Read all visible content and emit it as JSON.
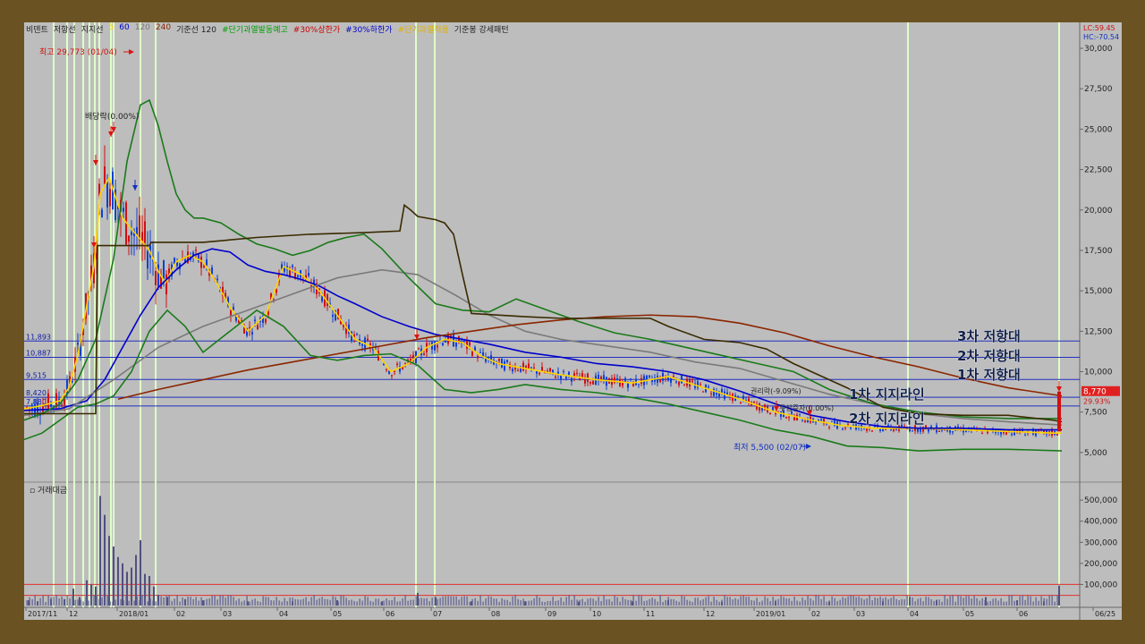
{
  "legend": [
    {
      "text": "비덴트",
      "color": "#222222"
    },
    {
      "text": "저항선",
      "color": "#222222"
    },
    {
      "text": "지지선",
      "color": "#222222"
    },
    {
      "text": "5",
      "color": "#ffd400"
    },
    {
      "text": "60",
      "color": "#0000cc"
    },
    {
      "text": "120",
      "color": "#777777"
    },
    {
      "text": "240",
      "color": "#8b2500"
    },
    {
      "text": "기준선 120",
      "color": "#222222"
    },
    {
      "text": "#단기과열발동예고",
      "color": "#00a000"
    },
    {
      "text": "#30%상한가",
      "color": "#cc0000"
    },
    {
      "text": "#30%하한가",
      "color": "#0000cc"
    },
    {
      "text": "#단기과열적용",
      "color": "#e0b000"
    },
    {
      "text": "기준봉 강세패턴",
      "color": "#222222"
    }
  ],
  "corner": {
    "lc": "LC:59.45",
    "hc": "HC:-70.54"
  },
  "volume_label": "거래대금",
  "annotations": {
    "high": "최고 29,773 (01/04)",
    "low": "최저 5,500 (02/07)",
    "dividend": "배당락(0.00%)",
    "rights": "권리락(-9.09%)",
    "bonus": "무상증자(0.00%)",
    "resist3": "3차 저항대",
    "resist2": "2차 저항대",
    "resist1": "1차 저항대",
    "support1": "1차 지지라인",
    "support2": "2차 지지라인",
    "current_price": "8,770",
    "current_change": "29.93%"
  },
  "chart_data": {
    "type": "line",
    "title": "",
    "x_ticks": [
      "2017/11",
      "12",
      "2018/01",
      "02",
      "03",
      "04",
      "05",
      "06",
      "07",
      "08",
      "09",
      "10",
      "11",
      "12",
      "2019/01",
      "02",
      "03",
      "04",
      "05",
      "06",
      "06/25"
    ],
    "y_ticks": [
      "30,000",
      "27,500",
      "25,000",
      "22,500",
      "20,000",
      "17,500",
      "15,000",
      "12,500",
      "10,000",
      "7,500",
      "5,000"
    ],
    "ylim": [
      3500,
      30500
    ],
    "level_lines": [
      {
        "value": 11893,
        "label": "11,893"
      },
      {
        "value": 10887,
        "label": "10,887"
      },
      {
        "value": 9515,
        "label": "9,515"
      },
      {
        "value": 8420,
        "label": "8,420"
      },
      {
        "value": 7880,
        "label": "7,880"
      }
    ],
    "series": [
      {
        "color": "#ffd400",
        "x": [
          0,
          20,
          40,
          50,
          60,
          68,
          78,
          85,
          95,
          110,
          125,
          140,
          150,
          158,
          170,
          185,
          200,
          215,
          230,
          250,
          270,
          290,
          310,
          330,
          350,
          370,
          390,
          410,
          430,
          450,
          470,
          490,
          510,
          530,
          560,
          600,
          640,
          680,
          720,
          760,
          800,
          840,
          880,
          910,
          950,
          1000,
          1050,
          1100,
          1150,
          1160
        ],
        "y": [
          7700,
          7900,
          8200,
          9000,
          11000,
          13500,
          16500,
          21000,
          22000,
          19500,
          18500,
          17500,
          16200,
          15500,
          16800,
          17200,
          16800,
          15500,
          14000,
          12500,
          13500,
          16500,
          16000,
          15000,
          13500,
          12000,
          11500,
          10000,
          10500,
          11500,
          12000,
          11800,
          11000,
          10500,
          10200,
          9800,
          9500,
          9300,
          9700,
          9000,
          8300,
          7500,
          7000,
          6700,
          6500,
          6500,
          6400,
          6300,
          6200,
          6200
        ]
      },
      {
        "color": "#0000cc",
        "x": [
          0,
          40,
          70,
          90,
          110,
          130,
          150,
          170,
          190,
          210,
          230,
          250,
          270,
          290,
          310,
          330,
          350,
          370,
          400,
          430,
          460,
          490,
          520,
          560,
          600,
          640,
          680,
          720,
          760,
          800,
          840,
          880,
          920,
          960,
          1000,
          1050,
          1100,
          1160
        ],
        "y": [
          7600,
          7700,
          8200,
          9500,
          11500,
          13500,
          15200,
          16300,
          17200,
          17600,
          17400,
          16600,
          16200,
          16000,
          15700,
          15300,
          14700,
          14200,
          13400,
          12800,
          12300,
          12000,
          11700,
          11200,
          10900,
          10500,
          10300,
          10000,
          9500,
          8800,
          8000,
          7300,
          6900,
          6600,
          6500,
          6500,
          6400,
          6400
        ]
      },
      {
        "color": "#7a7a7a",
        "x": [
          0,
          50,
          100,
          150,
          200,
          250,
          300,
          350,
          400,
          440,
          480,
          520,
          560,
          600,
          650,
          700,
          750,
          800,
          850,
          900,
          950,
          1000,
          1050,
          1100,
          1160
        ],
        "y": [
          7300,
          7700,
          9500,
          11500,
          12800,
          13800,
          14800,
          15800,
          16300,
          16000,
          14800,
          13500,
          12500,
          12000,
          11600,
          11200,
          10600,
          10200,
          9400,
          8600,
          8000,
          7400,
          7100,
          6900,
          6700
        ]
      },
      {
        "color": "#8b2500",
        "x": [
          105,
          150,
          200,
          250,
          300,
          350,
          400,
          450,
          500,
          550,
          600,
          650,
          700,
          750,
          800,
          850,
          900,
          950,
          1000,
          1050,
          1100,
          1160
        ],
        "y": [
          8300,
          8900,
          9500,
          10100,
          10600,
          11100,
          11600,
          12100,
          12500,
          12900,
          13200,
          13400,
          13500,
          13400,
          13000,
          12400,
          11600,
          10900,
          10300,
          9600,
          9000,
          8500
        ]
      },
      {
        "color": "#1a7a1a",
        "x": [
          0,
          20,
          40,
          60,
          80,
          100,
          115,
          130,
          140,
          150,
          160,
          170,
          180,
          190,
          200,
          220,
          240,
          260,
          280,
          300,
          320,
          340,
          360,
          380,
          400,
          430,
          460,
          490,
          520,
          550,
          580,
          620,
          660,
          700,
          740,
          780,
          820,
          860,
          900,
          950,
          1000,
          1050,
          1100,
          1160
        ],
        "y": [
          7000,
          7400,
          8000,
          9500,
          12000,
          17000,
          23000,
          26500,
          26800,
          25200,
          23000,
          21000,
          20000,
          19500,
          19500,
          19200,
          18500,
          17900,
          17600,
          17200,
          17500,
          18000,
          18300,
          18500,
          17600,
          15800,
          14200,
          13800,
          13700,
          14500,
          13900,
          13100,
          12400,
          12000,
          11500,
          11000,
          10500,
          10000,
          8900,
          8000,
          7500,
          7200,
          7100,
          7100
        ]
      },
      {
        "color": "#1a7a1a",
        "x": [
          0,
          20,
          40,
          60,
          80,
          100,
          120,
          140,
          160,
          180,
          200,
          230,
          260,
          290,
          320,
          350,
          380,
          410,
          440,
          470,
          500,
          530,
          560,
          600,
          640,
          680,
          720,
          760,
          800,
          840,
          880,
          920,
          960,
          1000,
          1050,
          1100,
          1160
        ],
        "y": [
          5800,
          6200,
          7000,
          7800,
          8000,
          8500,
          10000,
          12500,
          13800,
          12800,
          11200,
          12500,
          13800,
          12800,
          11000,
          10700,
          11000,
          11100,
          10400,
          8900,
          8700,
          8900,
          9200,
          8900,
          8700,
          8400,
          8000,
          7500,
          7000,
          6400,
          6000,
          5400,
          5300,
          5100,
          5200,
          5200,
          5100
        ]
      },
      {
        "color": "#3a2a00",
        "x": [
          0,
          80,
          82,
          140,
          142,
          200,
          260,
          320,
          380,
          420,
          425,
          432,
          440,
          460,
          470,
          480,
          490,
          500,
          560,
          600,
          650,
          700,
          720,
          760,
          800,
          830,
          860,
          880,
          920,
          960,
          1000,
          1050,
          1100,
          1150,
          1160
        ],
        "y": [
          7400,
          7400,
          17800,
          17800,
          18000,
          18000,
          18300,
          18500,
          18600,
          18700,
          20300,
          20000,
          19600,
          19400,
          19200,
          18500,
          16000,
          13600,
          13400,
          13300,
          13300,
          13300,
          12800,
          12000,
          11800,
          11400,
          10500,
          10000,
          9000,
          7800,
          7400,
          7300,
          7300,
          7000,
          6900
        ]
      }
    ],
    "volume": {
      "ylim": [
        0,
        560000
      ],
      "y_ticks": [
        "500,000",
        "400,000",
        "300,000",
        "200,000",
        "100,000"
      ],
      "bars": [
        {
          "x": 5,
          "v": 25000
        },
        {
          "x": 15,
          "v": 20000
        },
        {
          "x": 30,
          "v": 30000
        },
        {
          "x": 45,
          "v": 30000
        },
        {
          "x": 55,
          "v": 80000
        },
        {
          "x": 62,
          "v": 40000
        },
        {
          "x": 70,
          "v": 120000
        },
        {
          "x": 75,
          "v": 100000
        },
        {
          "x": 80,
          "v": 90000
        },
        {
          "x": 85,
          "v": 520000
        },
        {
          "x": 90,
          "v": 430000
        },
        {
          "x": 95,
          "v": 330000
        },
        {
          "x": 100,
          "v": 280000
        },
        {
          "x": 105,
          "v": 230000
        },
        {
          "x": 110,
          "v": 200000
        },
        {
          "x": 115,
          "v": 160000
        },
        {
          "x": 120,
          "v": 180000
        },
        {
          "x": 125,
          "v": 240000
        },
        {
          "x": 130,
          "v": 310000
        },
        {
          "x": 135,
          "v": 150000
        },
        {
          "x": 140,
          "v": 140000
        },
        {
          "x": 145,
          "v": 90000
        },
        {
          "x": 150,
          "v": 50000
        },
        {
          "x": 160,
          "v": 40000
        },
        {
          "x": 180,
          "v": 30000
        },
        {
          "x": 200,
          "v": 25000
        },
        {
          "x": 250,
          "v": 20000
        },
        {
          "x": 300,
          "v": 20000
        },
        {
          "x": 350,
          "v": 25000
        },
        {
          "x": 400,
          "v": 20000
        },
        {
          "x": 440,
          "v": 60000
        },
        {
          "x": 460,
          "v": 40000
        },
        {
          "x": 500,
          "v": 20000
        },
        {
          "x": 560,
          "v": 20000
        },
        {
          "x": 620,
          "v": 18000
        },
        {
          "x": 680,
          "v": 20000
        },
        {
          "x": 720,
          "v": 25000
        },
        {
          "x": 780,
          "v": 18000
        },
        {
          "x": 840,
          "v": 20000
        },
        {
          "x": 900,
          "v": 18000
        },
        {
          "x": 960,
          "v": 20000
        },
        {
          "x": 990,
          "v": 40000
        },
        {
          "x": 1020,
          "v": 25000
        },
        {
          "x": 1075,
          "v": 40000
        },
        {
          "x": 1110,
          "v": 25000
        },
        {
          "x": 1140,
          "v": 20000
        },
        {
          "x": 1157,
          "v": 95000
        }
      ],
      "level_lines": [
        100000,
        48000
      ]
    }
  }
}
